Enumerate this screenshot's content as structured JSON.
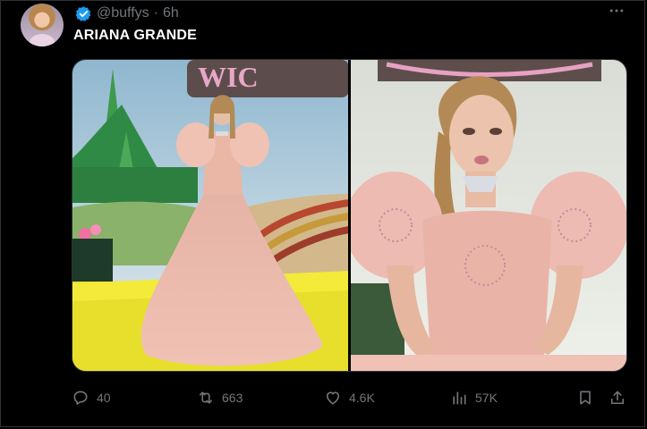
{
  "post": {
    "handle": "@buffys",
    "separator": "·",
    "time": "6h",
    "author_display": "ARIANA GRANDE",
    "verified": true
  },
  "actions": {
    "replies": "40",
    "reposts": "663",
    "likes": "4.6K",
    "views": "57K"
  },
  "colors": {
    "background": "#000000",
    "text": "#e7e9ea",
    "muted": "#71767b",
    "border": "#2f3336",
    "verified": "#1d9bf0"
  },
  "icons": {
    "more": "more-icon",
    "reply": "reply-icon",
    "repost": "repost-icon",
    "like": "heart-icon",
    "views": "views-icon",
    "bookmark": "bookmark-icon",
    "share": "share-icon"
  }
}
